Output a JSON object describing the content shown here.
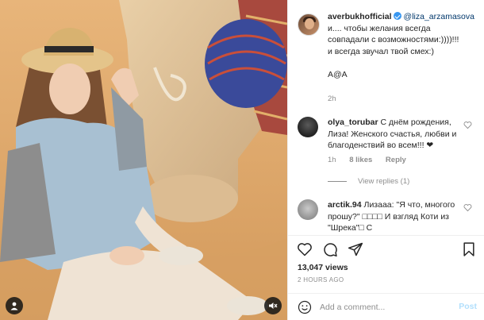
{
  "post": {
    "author": "averbukhofficial",
    "caption_mention": "@liza_arzamasova",
    "caption_lines": [
      "и.... чтобы желания всегда",
      "совпадали с возможностями:))))!!!",
      "и всегда звучал твой смех:)"
    ],
    "caption_signoff": "А@А",
    "time_ago": "2h"
  },
  "comments": [
    {
      "user": "olya_torubar",
      "text": "С днём рождения, Лиза! Женского счастья, любви и благоденствий во всем!!! ❤",
      "time": "1h",
      "likes": "8 likes",
      "reply_label": "Reply",
      "view_replies": "View replies (1)"
    },
    {
      "user": "arctik.94",
      "text": "Лизааа: \"Я что, многого прошу?\" □□□□ И взгляд Коти из \"Шрека\"□ С"
    }
  ],
  "stats": {
    "views": "13,047 views",
    "date": "2 HOURS AGO"
  },
  "add_comment": {
    "placeholder": "Add a comment...",
    "post_label": "Post"
  },
  "icons": {
    "like": "heart-icon",
    "comment": "comment-icon",
    "share": "paper-plane-icon",
    "save": "bookmark-icon",
    "emoji": "emoji-icon",
    "user_tag": "user-tag-icon",
    "mute": "speaker-muted-icon"
  },
  "colors": {
    "link": "#00376b",
    "verified": "#3897f0",
    "secondary_text": "#8e8e8e",
    "post_disabled": "#b2dffc"
  }
}
